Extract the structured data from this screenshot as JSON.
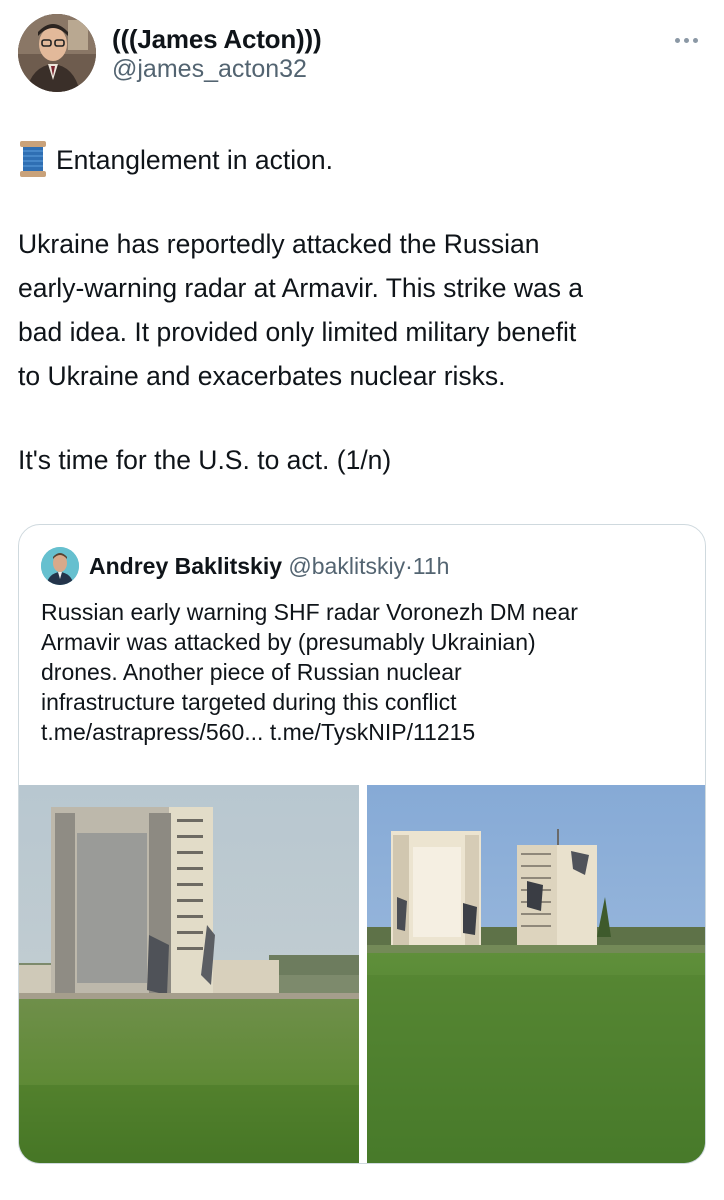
{
  "tweet": {
    "author": {
      "display_name": "(((James Acton)))",
      "handle": "@james_acton32"
    },
    "more_icon": "more-horizontal-icon",
    "lead_icon": "spool-of-thread-icon",
    "lines": [
      "Entanglement in action.",
      "Ukraine has reportedly attacked the Russian",
      "early-warning radar at Armavir. This strike was a",
      "bad idea. It provided only limited military benefit",
      "to Ukraine and exacerbates nuclear risks.",
      "It's time for the U.S. to act. (1/n)"
    ]
  },
  "quote": {
    "author": {
      "display_name": "Andrey Baklitskiy",
      "handle": "@baklitskiy",
      "separator": "·",
      "time": "11h"
    },
    "lines": [
      "Russian early warning SHF radar Voronezh DM near",
      "Armavir was attacked by (presumably Ukrainian)",
      "drones. Another piece of Russian nuclear",
      "infrastructure targeted during this conflict",
      "t.me/astrapress/560... t.me/TyskNIP/11215"
    ]
  },
  "colors": {
    "text_primary": "#0f1419",
    "text_secondary": "#536471",
    "border": "#cfd9de"
  }
}
